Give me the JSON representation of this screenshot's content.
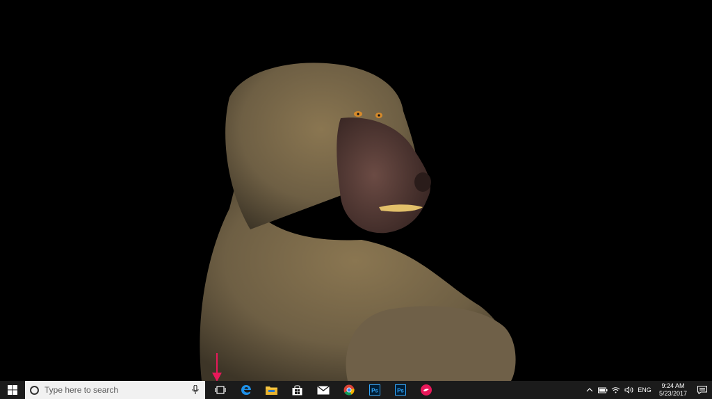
{
  "desktop": {
    "wallpaper_subject": "baboon",
    "background_color": "#000000"
  },
  "annotation": {
    "arrow_color": "#e8185a"
  },
  "taskbar": {
    "background_color": "#1b1b1b",
    "start_icon": "windows-logo-icon",
    "search": {
      "placeholder": "Type here to search",
      "icon": "cortana-icon",
      "mic_icon": "microphone-icon"
    },
    "task_view_icon": "task-view-icon",
    "pinned_apps": [
      {
        "name": "Microsoft Edge",
        "icon": "edge-icon",
        "color": "#1e90e8"
      },
      {
        "name": "File Explorer",
        "icon": "folder-icon",
        "color": "#f4c542"
      },
      {
        "name": "Store",
        "icon": "store-icon",
        "color": "#ffffff"
      },
      {
        "name": "Mail",
        "icon": "mail-icon",
        "color": "#ffffff"
      },
      {
        "name": "Google Chrome",
        "icon": "chrome-icon",
        "color": "#db4437"
      },
      {
        "name": "Photoshop",
        "label": "Ps",
        "icon": "photoshop-icon",
        "color": "#31a8ff"
      },
      {
        "name": "Photoshop",
        "label": "Ps",
        "icon": "photoshop-icon",
        "color": "#31a8ff"
      },
      {
        "name": "App",
        "icon": "app-pink-icon",
        "color": "#e8185a"
      }
    ],
    "tray": {
      "icons": [
        "chevron-up-icon",
        "battery-icon",
        "wifi-icon",
        "volume-icon"
      ],
      "language": "ENG",
      "time": "9:24 AM",
      "date": "5/23/2017",
      "action_center_icon": "notification-icon"
    }
  }
}
